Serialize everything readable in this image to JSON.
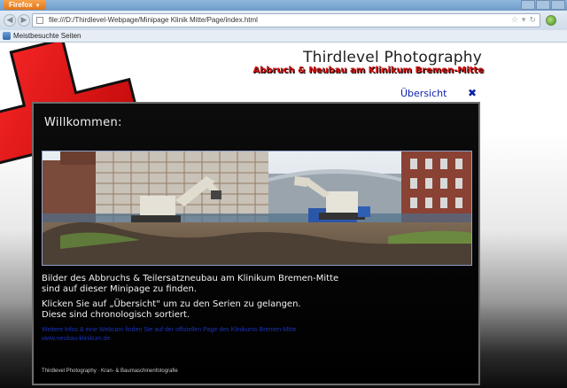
{
  "browser": {
    "app_button": "Firefox",
    "url": "file:///D:/Thirdlevel-Webpage/Minipage Klinik Mitte/Page/index.html",
    "bookmark_label": "Meistbesuchte Seiten"
  },
  "site": {
    "title": "Thirdlevel Photography",
    "subtitle": "Abbruch & Neubau am Klinikum Bremen-Mitte",
    "nav_link": "Übersicht",
    "close_glyph": "✖"
  },
  "content": {
    "heading": "Willkommen:",
    "para1_line1": "Bilder des Abbruchs & Teilersatzneubau am Klinikum Bremen-Mitte",
    "para1_line2": "sind auf dieser Minipage zu finden.",
    "para2_line1": "Klicken Sie auf „Übersicht\" um zu den Serien zu gelangen.",
    "para2_line2": "Diese sind chronologisch sortiert.",
    "info_link": "Weitere Infos & eine Webcam finden Sie auf der offiziellen Page des Klinikums Bremen-Mitte",
    "info_link2": "www.neubau-klinikum.de",
    "footer": "Thirdlevel Photography · Kran- & Baumaschinenfotografie"
  },
  "colors": {
    "accent_red": "#d61010",
    "link_blue": "#0b1fa8"
  }
}
